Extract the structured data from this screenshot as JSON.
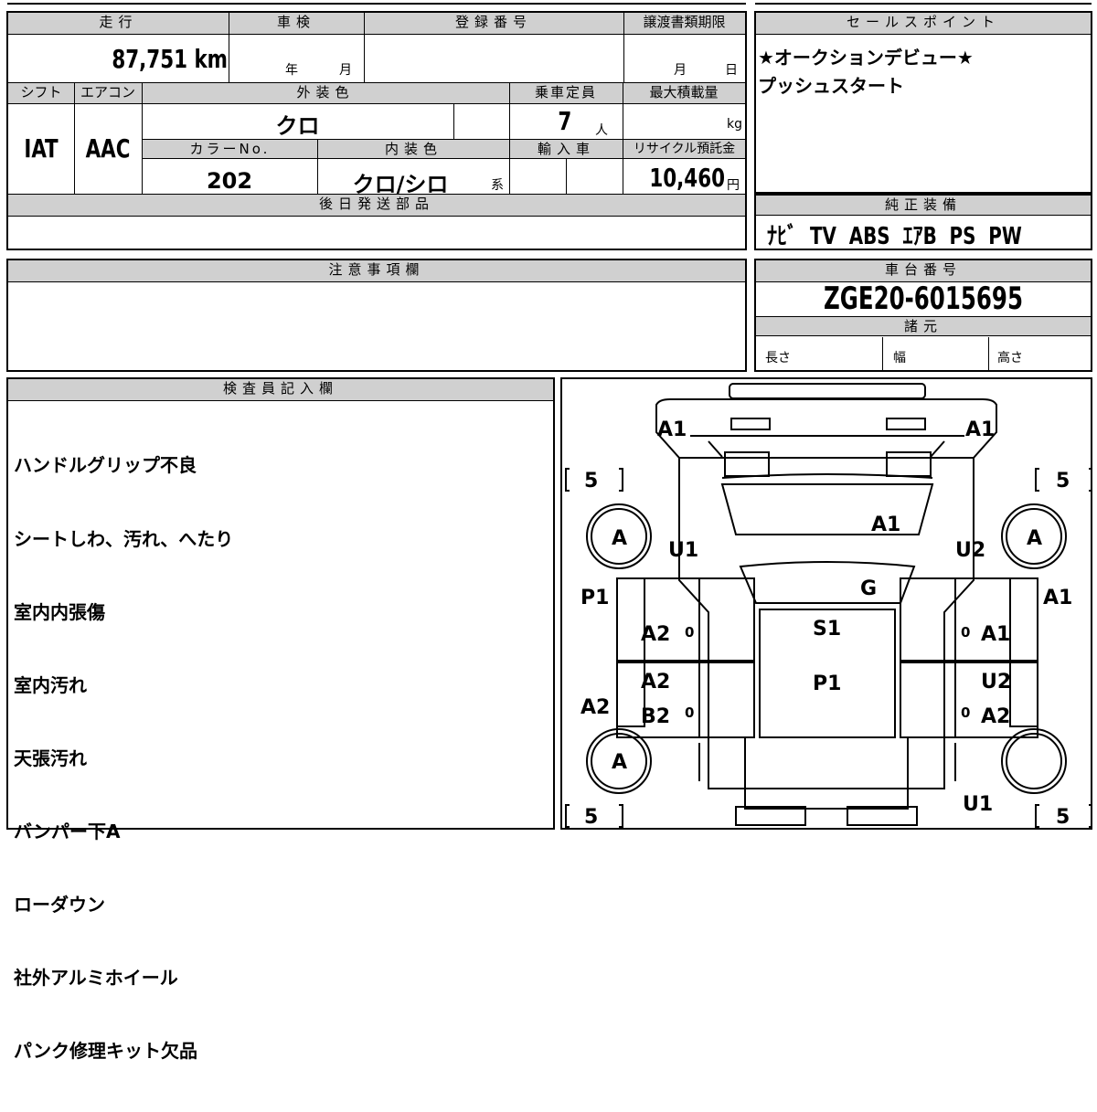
{
  "vehicle_info": {
    "mileage_label": "走行",
    "mileage_value": "87,751",
    "mileage_unit": "km",
    "inspection_label": "車検",
    "inspection_year_unit": "年",
    "inspection_month_unit": "月",
    "registration_label": "登録番号",
    "transfer_deadline_label": "譲渡書類期限",
    "transfer_month_unit": "月",
    "transfer_day_unit": "日",
    "shift_label": "シフト",
    "shift_value": "IAT",
    "ac_label": "エアコン",
    "ac_value": "AAC",
    "exterior_color_label": "外装色",
    "exterior_color_value": "クロ",
    "capacity_label": "乗車定員",
    "capacity_value": "7",
    "capacity_unit": "人",
    "max_load_label": "最大積載量",
    "max_load_unit": "kg",
    "color_no_label": "カラーNo.",
    "color_no_value": "202",
    "interior_color_label": "内装色",
    "interior_color_value": "クロ/シロ",
    "interior_color_suffix": "系",
    "import_label": "輸入車",
    "recycle_label": "リサイクル預託金",
    "recycle_value": "10,460",
    "recycle_unit": "円",
    "later_parts_label": "後日発送部品"
  },
  "sales_point": {
    "label": "セールスポイント",
    "lines": [
      "★オークションデビュー★",
      "プッシュスタート"
    ]
  },
  "genuine_equipment": {
    "label": "純正装備",
    "value": "ﾅﾋﾞ  TV  ABS  ｴｱB  PS  PW"
  },
  "notes": {
    "label": "注意事項欄"
  },
  "chassis": {
    "label": "車台番号",
    "value": "ZGE20-6015695",
    "specs_label": "諸元",
    "length_label": "長さ",
    "width_label": "幅",
    "height_label": "高さ"
  },
  "inspector": {
    "label": "検査員記入欄",
    "lines": [
      "ハンドルグリップ不良",
      "シートしわ、汚れ、へたり",
      "室内内張傷",
      "室内汚れ",
      "天張汚れ",
      "バンパー下A",
      "ローダウン",
      "社外アルミホイール",
      "パンク修理キット欠品"
    ]
  },
  "diagram": {
    "codes": {
      "front_bumper_left": "A1",
      "front_bumper_right": "A1",
      "tire_front_left_tread": "5",
      "tire_front_right_tread": "5",
      "tire_rear_left_tread": "5",
      "tire_rear_right_tread": "5",
      "wheel_front_left": "A",
      "wheel_front_right": "A",
      "wheel_rear_left": "A",
      "hood": "A1",
      "front_fender_left": "U1",
      "front_fender_right": "U2",
      "windshield": "G",
      "roof": "S1",
      "roof_rear": "P1",
      "left_pillar_front": "P1",
      "left_pillar_rear": "A2",
      "right_pillar_front": "A1",
      "front_door_left": "A2",
      "rear_door_left_1": "A2",
      "rear_door_left_2": "B2",
      "front_door_right": "A1",
      "rear_door_right_1": "U2",
      "rear_door_right_2": "A2",
      "rear_quarter_right": "U1",
      "door_mark_1": "0",
      "door_mark_2": "0",
      "door_mark_3": "0",
      "door_mark_4": "0"
    }
  }
}
